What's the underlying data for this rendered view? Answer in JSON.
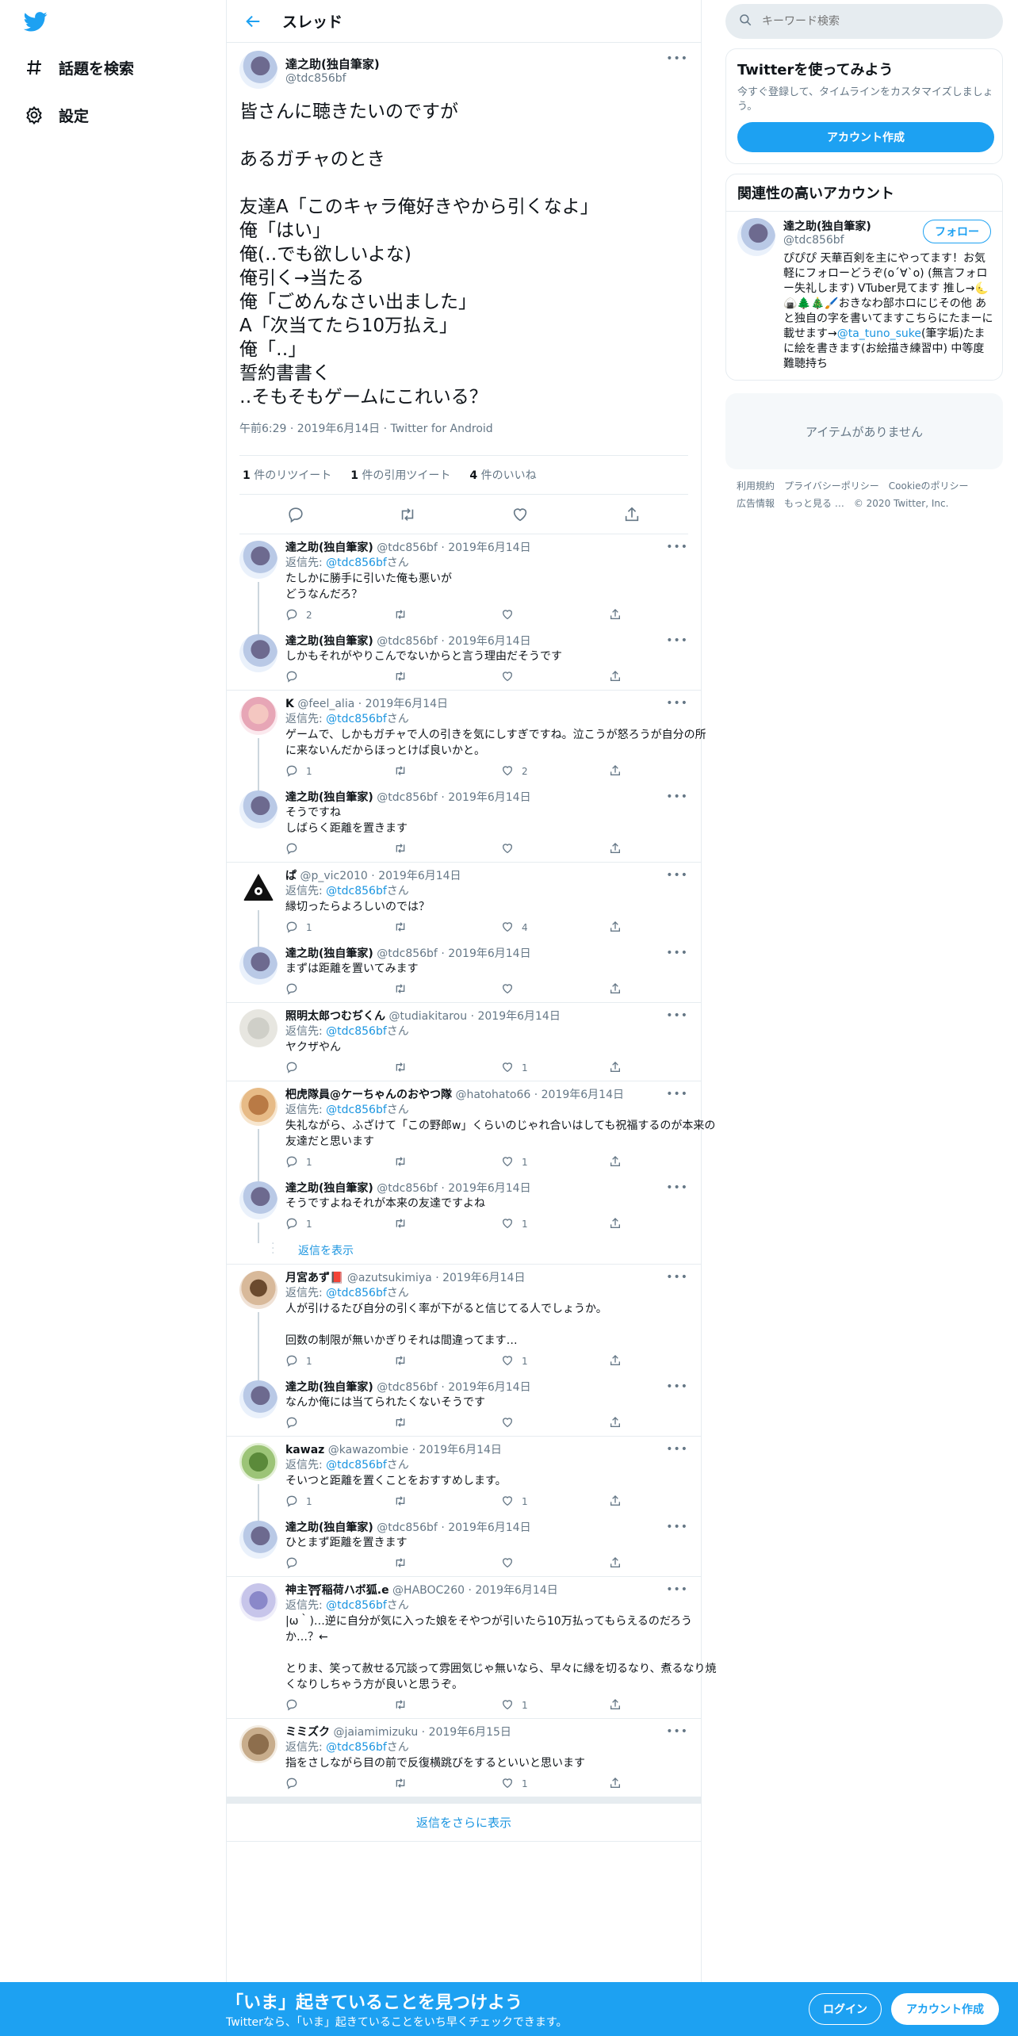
{
  "nav": {
    "items": [
      {
        "label": "話題を検索"
      },
      {
        "label": "設定"
      }
    ]
  },
  "header": {
    "title": "スレッド"
  },
  "main_tweet": {
    "display_name": "達之助(独自筆家)",
    "handle": "@tdc856bf",
    "text": "皆さんに聴きたいのですが\n\nあるガチャのとき\n\n友達A「このキャラ俺好きやから引くなよ」\n俺「はい」\n俺(‥でも欲しいよな)\n俺引く→当たる\n俺「ごめんなさい出ました」\nA「次当てたら10万払え」\n俺「‥」\n誓約書書く\n‥そもそもゲームにこれいる？",
    "meta": "午前6:29 · 2019年6月14日 · Twitter for Android",
    "retweets_count": "1",
    "retweets_label": "件のリツイート",
    "quotes_count": "1",
    "quotes_label": "件の引用ツイート",
    "likes_count": "4",
    "likes_label": "件のいいね"
  },
  "replies": [
    {
      "name": "達之助(独自筆家)",
      "handle": "@tdc856bf",
      "date": "2019年6月14日",
      "to_prefix": "返信先: ",
      "to": "@tdc856bf",
      "to_suffix": "さん",
      "text": "たしかに勝手に引いた俺も悪いが\nどうなんだろ？",
      "reply_count": "2",
      "rt_count": "",
      "like_count": ""
    },
    {
      "name": "達之助(独自筆家)",
      "handle": "@tdc856bf",
      "date": "2019年6月14日",
      "to_prefix": "",
      "to": "",
      "to_suffix": "",
      "text": "しかもそれがやりこんでないからと言う理由だそうです",
      "reply_count": "",
      "rt_count": "",
      "like_count": ""
    },
    {
      "name": "K",
      "handle": "@feel_alia",
      "date": "2019年6月14日",
      "to_prefix": "返信先: ",
      "to": "@tdc856bf",
      "to_suffix": "さん",
      "text": "ゲームで、しかもガチャで人の引きを気にしすぎですね。泣こうが怒ろうが自分の所に来ないんだからほっとけば良いかと。",
      "reply_count": "1",
      "rt_count": "",
      "like_count": "2"
    },
    {
      "name": "達之助(独自筆家)",
      "handle": "@tdc856bf",
      "date": "2019年6月14日",
      "to_prefix": "",
      "to": "",
      "to_suffix": "",
      "text": "そうですね\nしばらく距離を置きます",
      "reply_count": "",
      "rt_count": "",
      "like_count": ""
    },
    {
      "name": "ぱ",
      "handle": "@p_vic2010",
      "date": "2019年6月14日",
      "to_prefix": "返信先: ",
      "to": "@tdc856bf",
      "to_suffix": "さん",
      "text": "縁切ったらよろしいのでは？",
      "reply_count": "1",
      "rt_count": "",
      "like_count": "4"
    },
    {
      "name": "達之助(独自筆家)",
      "handle": "@tdc856bf",
      "date": "2019年6月14日",
      "to_prefix": "",
      "to": "",
      "to_suffix": "",
      "text": "まずは距離を置いてみます",
      "reply_count": "",
      "rt_count": "",
      "like_count": ""
    },
    {
      "name": "照明太郎つむぢくん",
      "handle": "@tudiakitarou",
      "date": "2019年6月14日",
      "to_prefix": "返信先: ",
      "to": "@tdc856bf",
      "to_suffix": "さん",
      "text": "ヤクザやん",
      "reply_count": "",
      "rt_count": "",
      "like_count": "1"
    },
    {
      "name": "杷虎隊員@ケーちゃんのおやつ隊",
      "handle": "@hatohato66",
      "date": "2019年6月14日",
      "to_prefix": "返信先: ",
      "to": "@tdc856bf",
      "to_suffix": "さん",
      "text": "失礼ながら、ふざけて「この野郎w」くらいのじゃれ合いはしても祝福するのが本来の友達だと思います",
      "reply_count": "1",
      "rt_count": "",
      "like_count": "1"
    },
    {
      "name": "達之助(独自筆家)",
      "handle": "@tdc856bf",
      "date": "2019年6月14日",
      "to_prefix": "",
      "to": "",
      "to_suffix": "",
      "text": "そうですよねそれが本来の友達ですよね",
      "reply_count": "1",
      "rt_count": "",
      "like_count": "1"
    },
    {
      "name": "月宮あず📕",
      "handle": "@azutsukimiya",
      "date": "2019年6月14日",
      "to_prefix": "返信先: ",
      "to": "@tdc856bf",
      "to_suffix": "さん",
      "text": "人が引けるたび自分の引く率が下がると信じてる人でしょうか。\n\n回数の制限が無いかぎりそれは間違ってます…",
      "reply_count": "1",
      "rt_count": "",
      "like_count": "1"
    },
    {
      "name": "達之助(独自筆家)",
      "handle": "@tdc856bf",
      "date": "2019年6月14日",
      "to_prefix": "",
      "to": "",
      "to_suffix": "",
      "text": "なんか俺には当てられたくないそうです",
      "reply_count": "",
      "rt_count": "",
      "like_count": ""
    },
    {
      "name": "kawaz",
      "handle": "@kawazombie",
      "date": "2019年6月14日",
      "to_prefix": "返信先: ",
      "to": "@tdc856bf",
      "to_suffix": "さん",
      "text": "そいつと距離を置くことをおすすめします。",
      "reply_count": "1",
      "rt_count": "",
      "like_count": "1"
    },
    {
      "name": "達之助(独自筆家)",
      "handle": "@tdc856bf",
      "date": "2019年6月14日",
      "to_prefix": "",
      "to": "",
      "to_suffix": "",
      "text": "ひとまず距離を置きます",
      "reply_count": "",
      "rt_count": "",
      "like_count": ""
    },
    {
      "name": "神主⛩稲荷ハボ狐.e",
      "handle": "@HABOC260",
      "date": "2019年6月14日",
      "to_prefix": "返信先: ",
      "to": "@tdc856bf",
      "to_suffix": "さん",
      "text": "|ω｀)…逆に自分が気に入った娘をそやつが引いたら10万払ってもらえるのだろうか…？←\n\nとりま、笑って赦せる冗談って雰囲気じゃ無いなら、早々に縁を切るなり、煮るなり焼くなりしちゃう方が良いと思うぞ。",
      "reply_count": "",
      "rt_count": "",
      "like_count": "1"
    },
    {
      "name": "ミミズク",
      "handle": "@jaiamimizuku",
      "date": "2019年6月15日",
      "to_prefix": "返信先: ",
      "to": "@tdc856bf",
      "to_suffix": "さん",
      "text": "指をさしながら目の前で反復横跳びをするといいと思います",
      "reply_count": "",
      "rt_count": "",
      "like_count": "1"
    }
  ],
  "show_replies_label": "返信を表示",
  "more_replies_label": "返信をさらに表示",
  "search": {
    "placeholder": "キーワード検索"
  },
  "signup_card": {
    "title": "Twitterを使ってみよう",
    "desc": "今すぐ登録して、タイムラインをカスタマイズしましょう。",
    "button": "アカウント作成"
  },
  "related": {
    "title": "関連性の高いアカウント",
    "name": "達之助(独自筆家)",
    "handle": "@tdc856bf",
    "follow": "フォロー",
    "bio_a": "ぴぴぴ 天華百剣を主にやってます！お気軽にフォローどうぞ(o´∀`o) (無言フォロー失礼します) VTuber見てます 推し→🌜🍙🌲🎄🖌️おきなわ部ホロにじその他 あと独自の字を書いてますこちらにたまーに載せます→",
    "bio_link": "@ta_tuno_suke",
    "bio_b": "(筆字垢)たまに絵を書きます(お絵描き練習中) 中等度難聴持ち"
  },
  "empty_box": "アイテムがありません",
  "footer": {
    "links": [
      "利用規約",
      "プライバシーポリシー",
      "Cookieのポリシー",
      "広告情報",
      "もっと見る …"
    ],
    "copyright": "© 2020 Twitter, Inc."
  },
  "bottom_bar": {
    "title": "「いま」起きていることを見つけよう",
    "subtitle": "Twitterなら、「いま」起きていることをいち早くチェックできます。",
    "login": "ログイン",
    "signup": "アカウント作成"
  },
  "colors": {
    "accent": "#1da1f2",
    "link": "#1b95e0",
    "muted": "#657786",
    "border": "#e6ecf0"
  }
}
